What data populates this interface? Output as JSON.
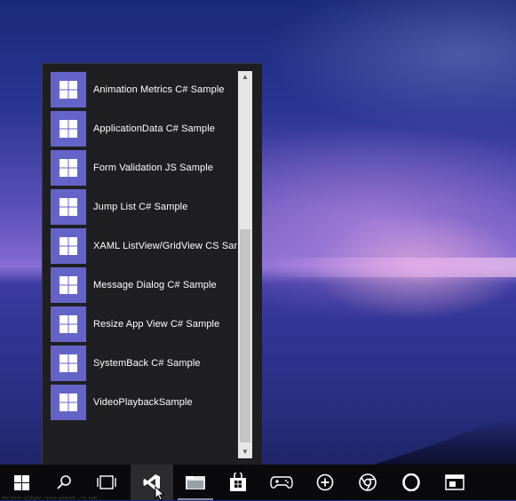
{
  "jump_list": {
    "items": [
      {
        "label": "Animation Metrics C# Sample"
      },
      {
        "label": "ApplicationData C# Sample"
      },
      {
        "label": "Form Validation JS Sample"
      },
      {
        "label": "Jump List C# Sample"
      },
      {
        "label": "XAML ListView/GridView CS Sample"
      },
      {
        "label": "Message Dialog C# Sample"
      },
      {
        "label": "Resize App View C# Sample"
      },
      {
        "label": "SystemBack C# Sample"
      },
      {
        "label": "VideoPlaybackSample"
      }
    ],
    "tile_icon": "windows-logo-icon",
    "tile_color": "#6464c8"
  },
  "taskbar": {
    "buttons": [
      {
        "icon": "start-windows-icon"
      },
      {
        "icon": "search-icon"
      },
      {
        "icon": "task-view-icon"
      },
      {
        "icon": "visual-studio-icon",
        "active": true
      },
      {
        "icon": "file-explorer-icon"
      },
      {
        "icon": "store-icon"
      },
      {
        "icon": "xbox-controller-icon"
      },
      {
        "icon": "zoom-in-icon"
      },
      {
        "icon": "chrome-icon"
      },
      {
        "icon": "opera-icon"
      },
      {
        "icon": "app-window-icon"
      }
    ]
  },
  "watermark": "the birds of flight / www.winkwit.../ to hall..."
}
